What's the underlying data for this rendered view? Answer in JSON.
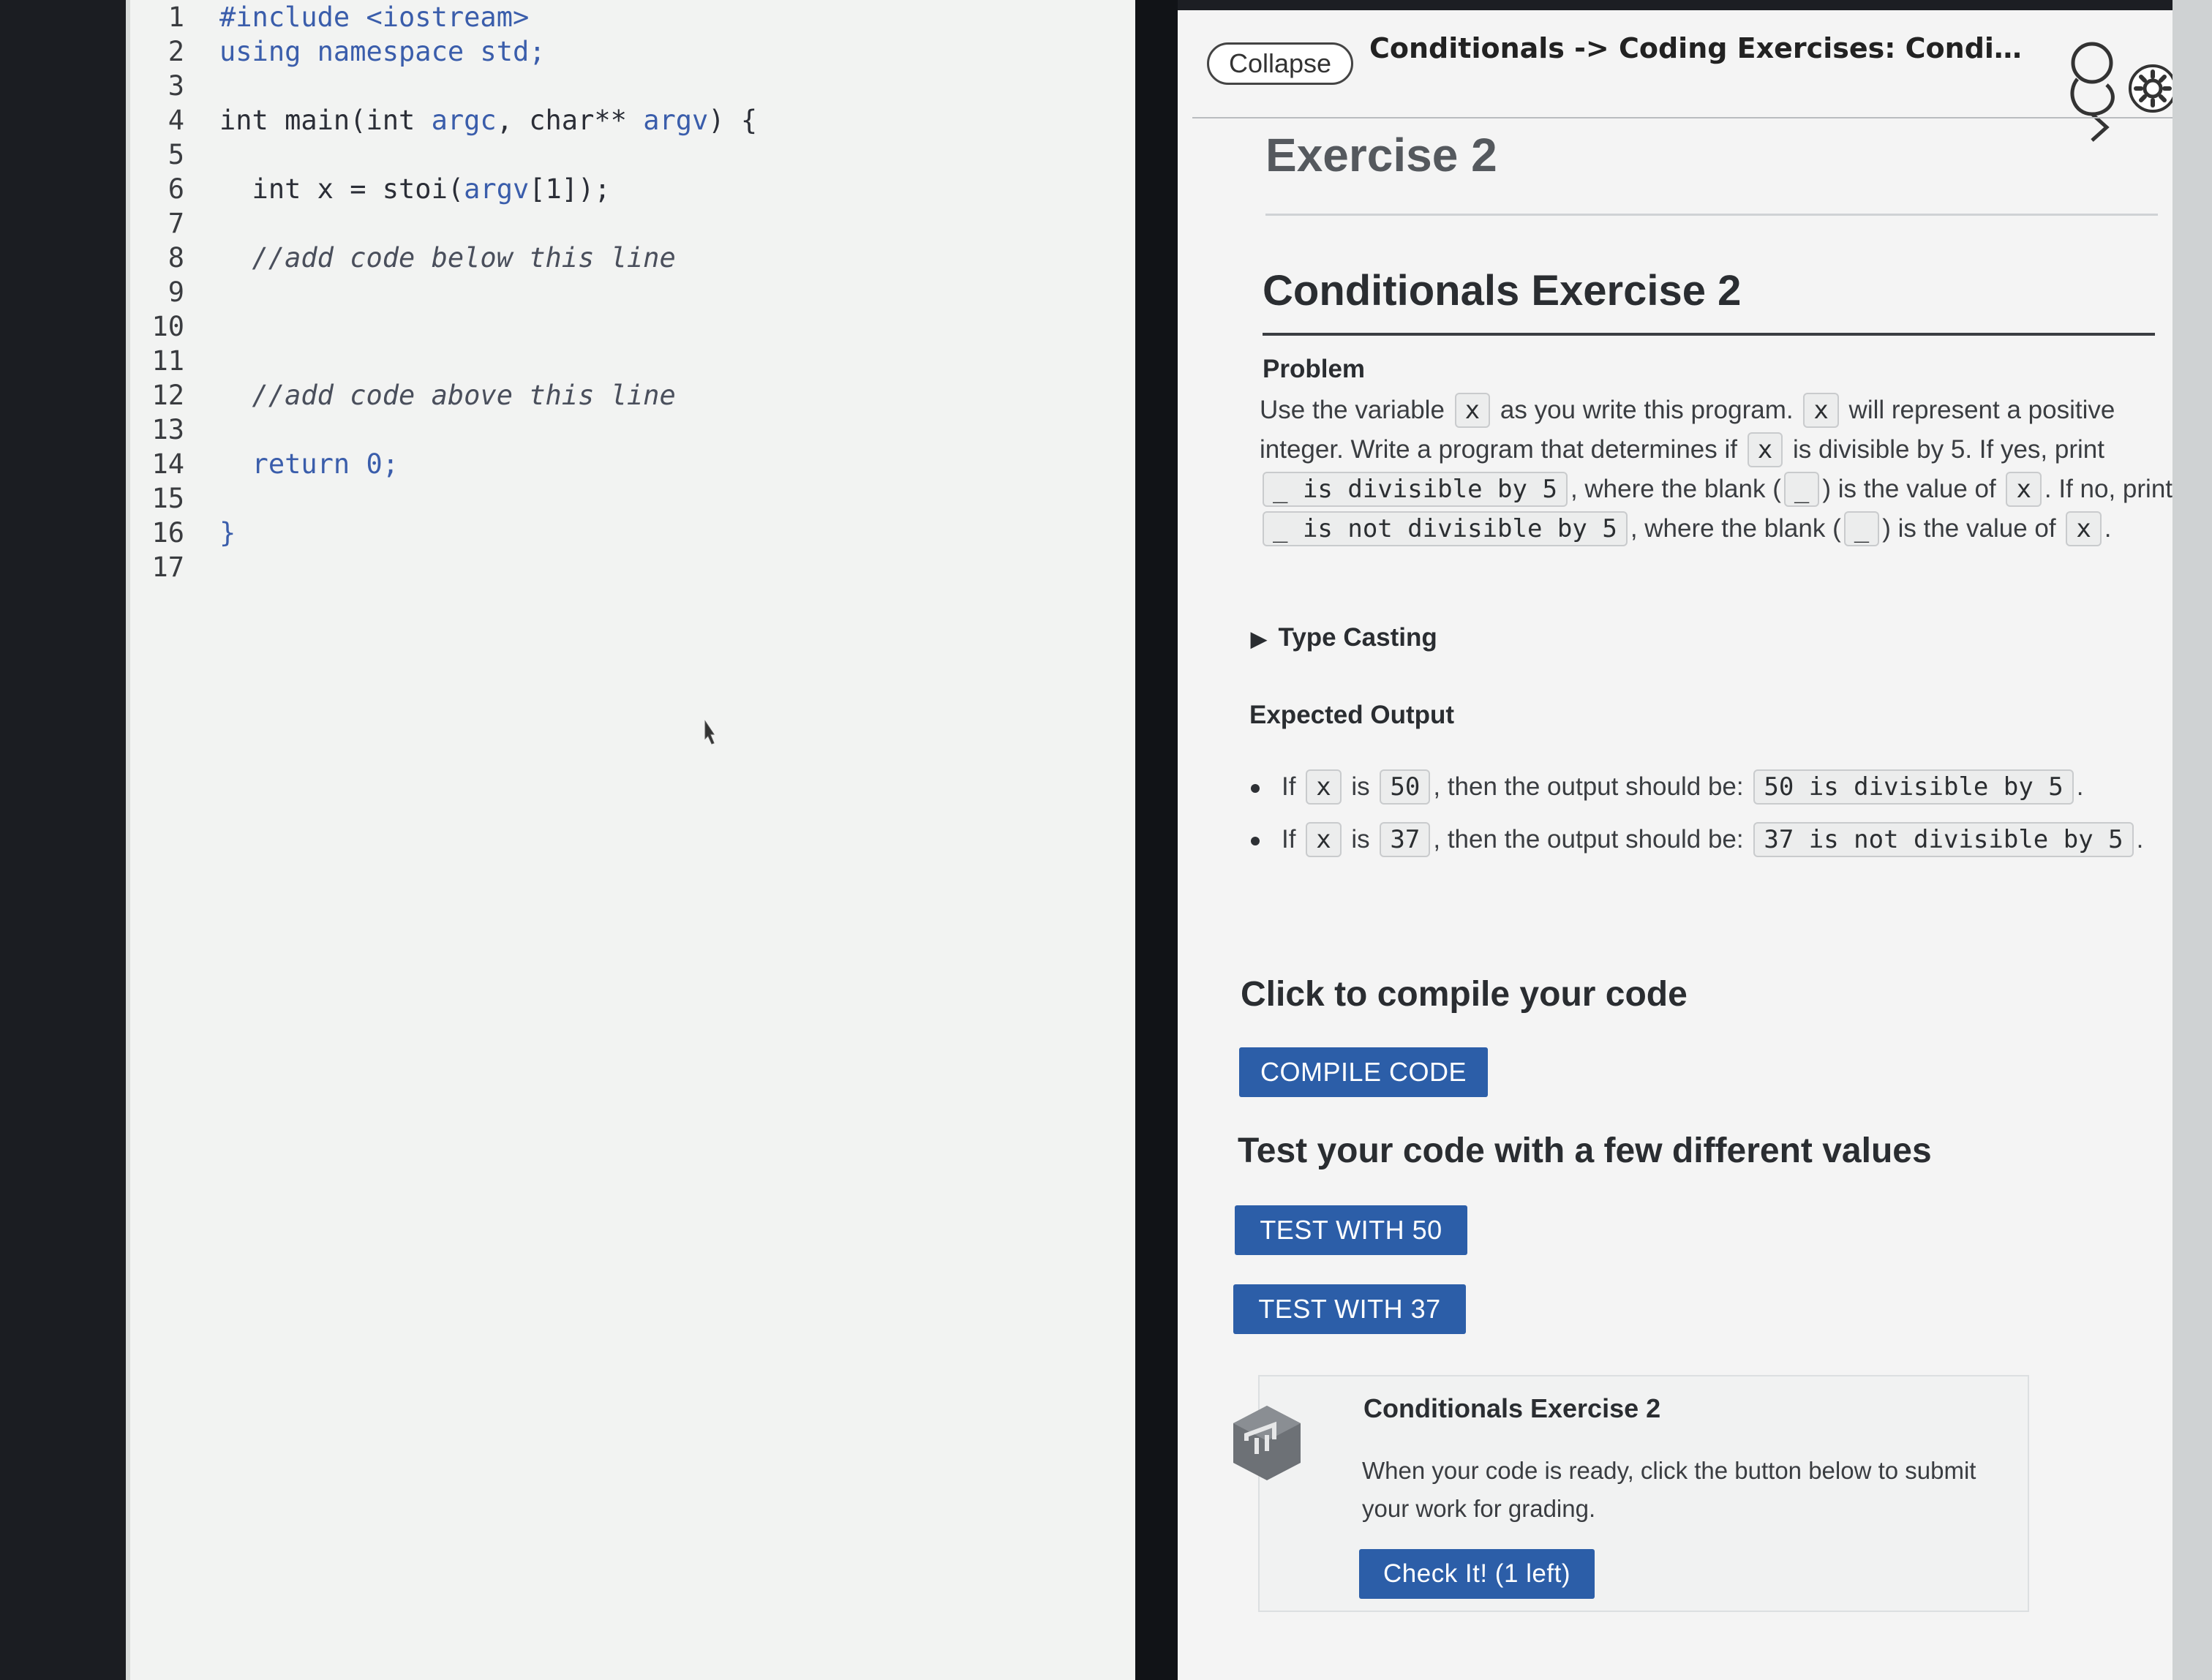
{
  "editor": {
    "lines": [
      {
        "n": "1",
        "parts": [
          {
            "t": "#include <iostream>",
            "c": "kw"
          }
        ]
      },
      {
        "n": "2",
        "parts": [
          {
            "t": "using namespace std;",
            "c": "kw"
          }
        ]
      },
      {
        "n": "3",
        "parts": []
      },
      {
        "n": "4",
        "parts": [
          {
            "t": "int main(int ",
            "c": ""
          },
          {
            "t": "argc",
            "c": "kw"
          },
          {
            "t": ", char** ",
            "c": ""
          },
          {
            "t": "argv",
            "c": "kw"
          },
          {
            "t": ") {",
            "c": ""
          }
        ]
      },
      {
        "n": "5",
        "parts": []
      },
      {
        "n": "6",
        "parts": [
          {
            "t": "  int x = stoi(",
            "c": ""
          },
          {
            "t": "argv",
            "c": "kw"
          },
          {
            "t": "[1]);",
            "c": ""
          }
        ]
      },
      {
        "n": "7",
        "parts": []
      },
      {
        "n": "8",
        "parts": [
          {
            "t": "  //add code below this line",
            "c": "cm"
          }
        ]
      },
      {
        "n": "9",
        "parts": []
      },
      {
        "n": "10",
        "parts": []
      },
      {
        "n": "11",
        "parts": []
      },
      {
        "n": "12",
        "parts": [
          {
            "t": "  //add code above this line",
            "c": "cm"
          }
        ]
      },
      {
        "n": "13",
        "parts": []
      },
      {
        "n": "14",
        "parts": [
          {
            "t": "  return 0;",
            "c": "kw"
          }
        ]
      },
      {
        "n": "15",
        "parts": []
      },
      {
        "n": "16",
        "parts": [
          {
            "t": "}",
            "c": "br"
          }
        ]
      },
      {
        "n": "17",
        "parts": []
      }
    ]
  },
  "header": {
    "collapse_label": "Collapse",
    "title": "Conditionals -> Coding Exercises: Condi…",
    "icons": [
      "guide-icon",
      "gear-icon"
    ]
  },
  "page": {
    "exercise_heading": "Exercise 2",
    "section_heading": "Conditionals Exercise 2",
    "problem_heading": "Problem",
    "problem": {
      "t1": "Use the variable",
      "var": "x",
      "t2": "as you write this program.",
      "t3": "will represent a positive integer. Write a program that determines if",
      "t4": "is divisible by 5. If yes, print",
      "msg_yes": "_ is divisible by 5",
      "t5": ", where the blank (",
      "blank": "_",
      "t6": ") is the value of",
      "t7": ". If no, print",
      "msg_no": "_ is not divisible by 5",
      "t8": ", where the blank (",
      "t9": ") is the value of",
      "t10": "."
    },
    "details_label": "Type Casting",
    "expected_heading": "Expected Output",
    "expected": {
      "if": "If",
      "is": "is",
      "then": ", then the output should be:",
      "val_a": "50",
      "out_a": "50 is divisible by 5",
      "val_b": "37",
      "out_b": "37 is not divisible by 5",
      "end": "."
    },
    "compile_heading": "Click to compile your code",
    "compile_button": "COMPILE CODE",
    "test_heading": "Test your code with a few different values",
    "test_50_button": "TEST WITH 50",
    "test_37_button": "TEST WITH 37",
    "card": {
      "title": "Conditionals Exercise 2",
      "text": "When your code is ready, click the button below to submit your work for grading.",
      "button": "Check It! (1 left)"
    }
  },
  "colors": {
    "accent": "#2c5ea8",
    "editor_bg": "#f2f3f2",
    "panel_bg": "#f4f4f4"
  }
}
